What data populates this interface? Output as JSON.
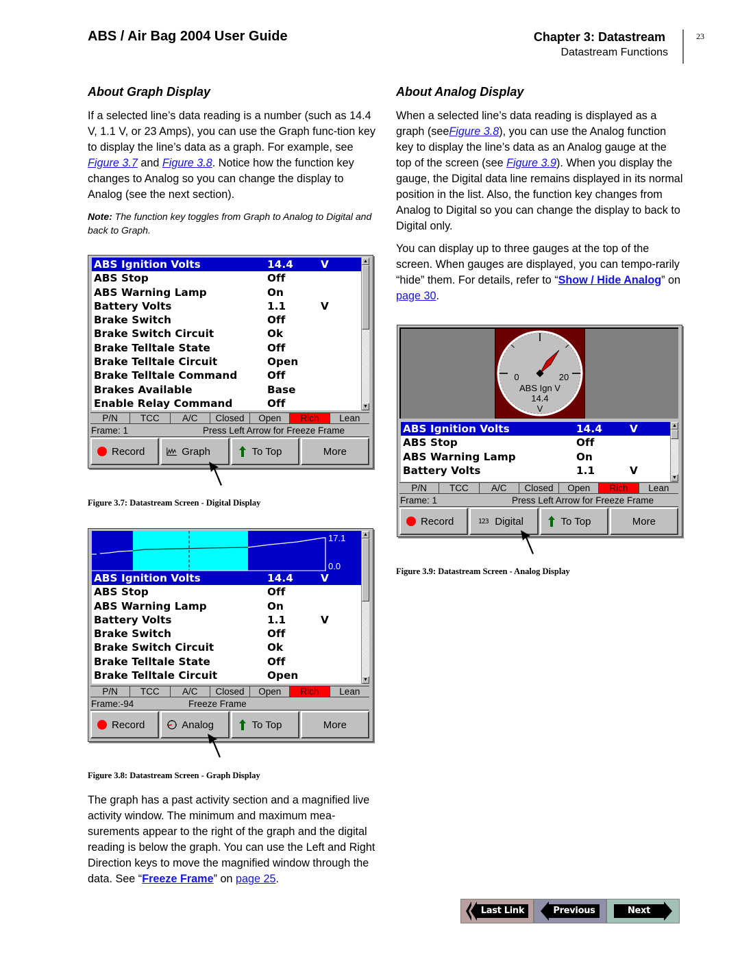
{
  "header": {
    "doc_title": "ABS / Air Bag 2004 User Guide",
    "chapter": "Chapter 3: Datastream",
    "section": "Datastream Functions",
    "page_number": "23"
  },
  "left": {
    "heading": "About Graph Display",
    "para1": {
      "t1": "If a selected line’s data reading is a number (such as 14.4 V, 1.1 V, or 23 Amps), you can use the Graph func-tion key to display the line’s data as a graph. For example, see ",
      "link1": "Figure 3.7",
      "t2": " and ",
      "link2": "Figure 3.8",
      "t3": ". Notice how the function key changes to Analog so you can change the display to Analog (see the next section)."
    },
    "note": {
      "label": "Note:",
      "text": " The function key toggles from Graph to Analog to Digital and back to Graph."
    },
    "para2": {
      "t1": "The graph has a past activity section and a magnified live activity window. The minimum and maximum mea-surements appear to the right of the graph and the digital reading is below the graph. You can use the Left and Right Direction keys to move the magnified window through the data. See “",
      "link1": "Freeze Frame",
      "t2": "” on ",
      "link2": "page 25",
      "t3": "."
    }
  },
  "right": {
    "heading": "About Analog Display",
    "para1": {
      "t1": "When a selected line’s data reading is displayed as a graph (see",
      "link1": "Figure 3.8",
      "t2": "), you can use the Analog function key to display the line’s data as an Analog gauge at the top of the screen (see ",
      "link2": "Figure 3.9",
      "t3": "). When you display the gauge, the Digital data line remains displayed in its normal position in the list. Also, the function key changes from Analog to Digital so you can change the display to back to Digital only."
    },
    "para2": {
      "t1": "You can display up to three gauges at the top of the screen. When gauges are displayed, you can tempo-rarily “hide” them. For details, refer to “",
      "link1": "Show / Hide Analog",
      "t2": "” on ",
      "link2": "page 30",
      "t3": "."
    }
  },
  "status_cells": [
    "P/N",
    "TCC",
    "A/C",
    "Closed",
    "Open",
    "Rich",
    "Lean"
  ],
  "status_hot_index": 5,
  "figures": {
    "fig37": {
      "caption": "Figure 3.7: Datastream Screen - Digital Display",
      "rows": [
        {
          "name": "ABS Ignition Volts",
          "value": "14.4",
          "unit": "V",
          "selected": true
        },
        {
          "name": "ABS Stop",
          "value": "Off",
          "unit": ""
        },
        {
          "name": "ABS Warning Lamp",
          "value": "On",
          "unit": ""
        },
        {
          "name": "Battery Volts",
          "value": "1.1",
          "unit": "V"
        },
        {
          "name": "Brake Switch",
          "value": "Off",
          "unit": ""
        },
        {
          "name": "Brake Switch Circuit",
          "value": "Ok",
          "unit": ""
        },
        {
          "name": "Brake Telltale State",
          "value": "Off",
          "unit": ""
        },
        {
          "name": "Brake Telltale Circuit",
          "value": "Open",
          "unit": ""
        },
        {
          "name": "Brake Telltale Command",
          "value": "Off",
          "unit": ""
        },
        {
          "name": "Brakes Available",
          "value": "Base",
          "unit": ""
        },
        {
          "name": "Enable Relay Command",
          "value": "Off",
          "unit": ""
        }
      ],
      "frame_label": "Frame: 1",
      "frame_message": "Press Left Arrow for Freeze Frame",
      "fkeys": [
        "Record",
        "Graph",
        "To Top",
        "More"
      ]
    },
    "fig38": {
      "caption": "Figure 3.8: Datastream Screen - Graph Display",
      "graph_max": "17.1",
      "graph_min": "0.0",
      "rows": [
        {
          "name": "ABS Ignition Volts",
          "value": "14.4",
          "unit": "V",
          "selected": true
        },
        {
          "name": "ABS Stop",
          "value": "Off",
          "unit": ""
        },
        {
          "name": "ABS Warning Lamp",
          "value": "On",
          "unit": ""
        },
        {
          "name": "Battery Volts",
          "value": "1.1",
          "unit": "V"
        },
        {
          "name": "Brake Switch",
          "value": "Off",
          "unit": ""
        },
        {
          "name": "Brake Switch Circuit",
          "value": "Ok",
          "unit": ""
        },
        {
          "name": "Brake Telltale State",
          "value": "Off",
          "unit": ""
        },
        {
          "name": "Brake Telltale Circuit",
          "value": "Open",
          "unit": ""
        }
      ],
      "frame_label": "Frame:-94",
      "frame_message": "Freeze Frame",
      "fkeys": [
        "Record",
        "Analog",
        "To Top",
        "More"
      ]
    },
    "fig39": {
      "caption": "Figure 3.9: Datastream Screen - Analog Display",
      "gauge": {
        "min_label": "0",
        "max_label": "20",
        "name": "ABS Ign V",
        "value": "14.4",
        "unit": "V",
        "value_num": 14.4,
        "range_min": 0,
        "range_max": 20
      },
      "rows": [
        {
          "name": "ABS Ignition Volts",
          "value": "14.4",
          "unit": "V",
          "selected": true
        },
        {
          "name": "ABS Stop",
          "value": "Off",
          "unit": ""
        },
        {
          "name": "ABS Warning Lamp",
          "value": "On",
          "unit": ""
        },
        {
          "name": "Battery Volts",
          "value": "1.1",
          "unit": "V"
        }
      ],
      "frame_label": "Frame: 1",
      "frame_message": "Press Left Arrow for Freeze Frame",
      "fkeys": [
        "Record",
        "Digital",
        "To Top",
        "More"
      ]
    }
  },
  "nav": {
    "last_link": "Last Link",
    "previous": "Previous",
    "next": "Next"
  },
  "colors": {
    "link": "#1414e6",
    "selected_row": "#0000c8",
    "status_hot": "#ff0000",
    "graph_window": "#00ffff",
    "gauge_bg": "#6a0000",
    "needle": "#cc0000"
  }
}
